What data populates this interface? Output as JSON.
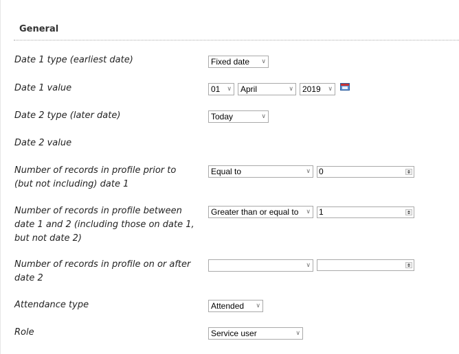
{
  "section": {
    "title": "General"
  },
  "rows": {
    "date1_type": {
      "label": "Date 1 type (earliest date)",
      "value": "Fixed date"
    },
    "date1_value": {
      "label": "Date 1 value",
      "day": "01",
      "month": "April",
      "year": "2019"
    },
    "date2_type": {
      "label": "Date 2 type (later date)",
      "value": "Today"
    },
    "date2_value": {
      "label": "Date 2 value"
    },
    "prior": {
      "label": "Number of records in profile prior to (but not including) date 1",
      "operator": "Equal to",
      "count": "0"
    },
    "between": {
      "label": "Number of records in profile between date 1 and 2 (including those on date 1, but not date 2)",
      "operator": "Greater than or equal to",
      "count": "1"
    },
    "after": {
      "label": "Number of records in profile on or after date 2",
      "operator": "",
      "count": ""
    },
    "attendance": {
      "label": "Attendance type",
      "value": "Attended"
    },
    "role": {
      "label": "Role",
      "value": "Service user"
    }
  },
  "icons": {
    "dropdown": "chevron-down-icon",
    "spinner": "spinner-icon",
    "calendar": "calendar-icon"
  }
}
